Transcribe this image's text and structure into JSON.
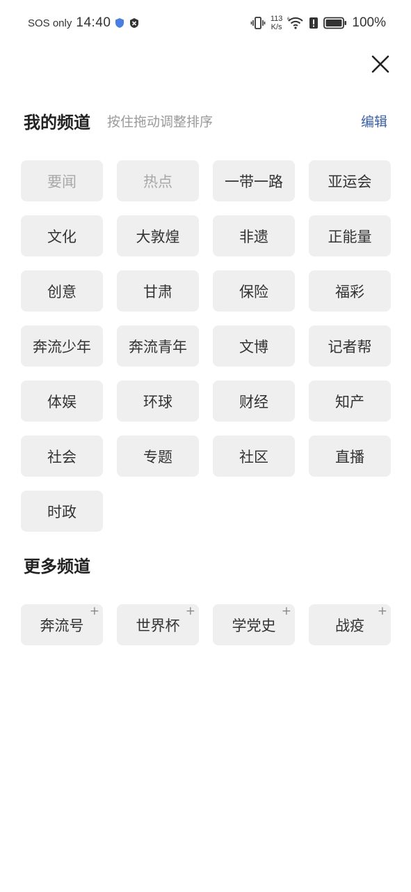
{
  "status_bar": {
    "carrier": "SOS only",
    "time": "14:40",
    "net_speed_value": "113",
    "net_speed_unit": "K/s",
    "battery": "100%"
  },
  "header": {
    "close_icon": "close-icon"
  },
  "my_channels": {
    "title": "我的频道",
    "hint": "按住拖动调整排序",
    "edit_label": "编辑",
    "items": [
      {
        "label": "要闻",
        "fixed": true
      },
      {
        "label": "热点",
        "fixed": true
      },
      {
        "label": "一带一路",
        "fixed": false
      },
      {
        "label": "亚运会",
        "fixed": false
      },
      {
        "label": "文化",
        "fixed": false
      },
      {
        "label": "大敦煌",
        "fixed": false
      },
      {
        "label": "非遗",
        "fixed": false
      },
      {
        "label": "正能量",
        "fixed": false
      },
      {
        "label": "创意",
        "fixed": false
      },
      {
        "label": "甘肃",
        "fixed": false
      },
      {
        "label": "保险",
        "fixed": false
      },
      {
        "label": "福彩",
        "fixed": false
      },
      {
        "label": "奔流少年",
        "fixed": false
      },
      {
        "label": "奔流青年",
        "fixed": false
      },
      {
        "label": "文博",
        "fixed": false
      },
      {
        "label": "记者帮",
        "fixed": false
      },
      {
        "label": "体娱",
        "fixed": false
      },
      {
        "label": "环球",
        "fixed": false
      },
      {
        "label": "财经",
        "fixed": false
      },
      {
        "label": "知产",
        "fixed": false
      },
      {
        "label": "社会",
        "fixed": false
      },
      {
        "label": "专题",
        "fixed": false
      },
      {
        "label": "社区",
        "fixed": false
      },
      {
        "label": "直播",
        "fixed": false
      },
      {
        "label": "时政",
        "fixed": false
      }
    ]
  },
  "more_channels": {
    "title": "更多频道",
    "add_symbol": "+",
    "items": [
      {
        "label": "奔流号"
      },
      {
        "label": "世界杯"
      },
      {
        "label": "学党史"
      },
      {
        "label": "战疫"
      }
    ]
  },
  "colors": {
    "accent": "#3a5fa8",
    "chip_bg": "#efefef",
    "fixed_text": "#a8a8a8"
  }
}
